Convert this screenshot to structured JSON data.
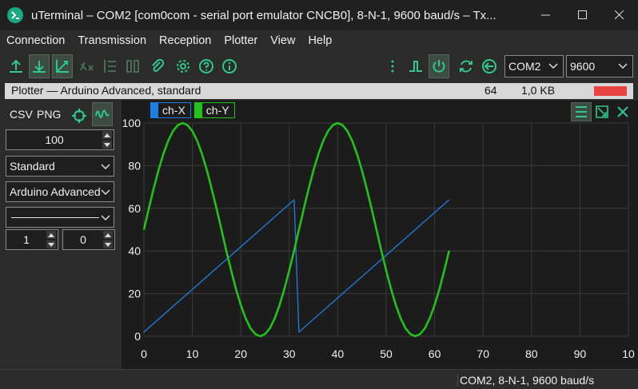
{
  "window": {
    "title": "uTerminal – COM2   [com0com - serial port emulator CNCB0], 8-N-1, 9600 baud/s – Tx...",
    "app_icon": "terminal-prompt-icon"
  },
  "menu": [
    "Connection",
    "Transmission",
    "Reception",
    "Plotter",
    "View",
    "Help"
  ],
  "toolbar": {
    "icons": [
      "upload-icon",
      "download-icon",
      "axes-icon",
      "clear-x-icon",
      "list-icon",
      "columns-icon",
      "attach-icon",
      "gear-icon",
      "help-icon",
      "info-icon",
      "more-icon",
      "signal-icon",
      "power-icon",
      "refresh-icon",
      "back-icon"
    ],
    "port": "COM2",
    "baud": "9600"
  },
  "infobar": {
    "label": "Plotter — Arduino Advanced, standard",
    "count": "64",
    "size": "1,0 KB",
    "indicator_color": "#e84343"
  },
  "leftpanel": {
    "csv_label": "CSV",
    "png_label": "PNG",
    "points": "100",
    "mode": "Standard",
    "format": "Arduino Advanced",
    "line_style": "",
    "spin_a": "1",
    "spin_b": "0"
  },
  "legend": [
    {
      "name": "ch-X",
      "color": "#1e7fe0"
    },
    {
      "name": "ch-Y",
      "color": "#22c21b"
    }
  ],
  "status": "COM2, 8-N-1, 9600 baud/s",
  "chart_data": {
    "type": "line",
    "xlim": [
      0,
      100
    ],
    "ylim": [
      0,
      100
    ],
    "xticks": [
      "0",
      "10",
      "20",
      "30",
      "40",
      "50",
      "60",
      "70",
      "80",
      "90",
      "10"
    ],
    "yticks": [
      "0",
      "20",
      "40",
      "60",
      "80",
      "100"
    ],
    "grid": true,
    "legend_position": "top-left",
    "series": [
      {
        "name": "ch-X",
        "color": "#1e7fe0",
        "x": [
          0,
          31,
          32,
          63
        ],
        "y": [
          2,
          64,
          2,
          64
        ]
      },
      {
        "name": "ch-Y",
        "color": "#22c21b",
        "x": [
          0,
          1,
          2,
          3,
          4,
          5,
          6,
          7,
          8,
          9,
          10,
          11,
          12,
          13,
          14,
          15,
          16,
          17,
          18,
          19,
          20,
          21,
          22,
          23,
          24,
          25,
          26,
          27,
          28,
          29,
          30,
          31,
          32,
          33,
          34,
          35,
          36,
          37,
          38,
          39,
          40,
          41,
          42,
          43,
          44,
          45,
          46,
          47,
          48,
          49,
          50,
          51,
          52,
          53,
          54,
          55,
          56,
          57,
          58,
          59,
          60,
          61,
          62,
          63
        ],
        "y": [
          50,
          59.8,
          69.1,
          77.8,
          85.4,
          91.6,
          96.2,
          99,
          100,
          99,
          96.2,
          91.6,
          85.4,
          77.8,
          69.1,
          59.8,
          50,
          40.2,
          30.9,
          22.2,
          14.6,
          8.4,
          3.8,
          1,
          0,
          1,
          3.8,
          8.4,
          14.6,
          22.2,
          30.9,
          40.2,
          50,
          59.8,
          69.1,
          77.8,
          85.4,
          91.6,
          96.2,
          99,
          100,
          99,
          96.2,
          91.6,
          85.4,
          77.8,
          69.1,
          59.8,
          50,
          40.2,
          30.9,
          22.2,
          14.6,
          8.4,
          3.8,
          1,
          0,
          1,
          3.8,
          8.4,
          14.6,
          22.2,
          30.9,
          40.2
        ]
      }
    ]
  }
}
